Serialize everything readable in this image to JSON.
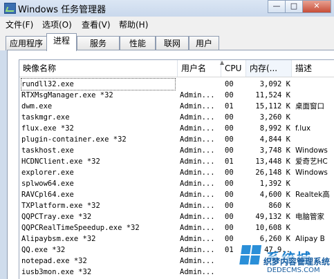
{
  "window": {
    "title": "Windows 任务管理器",
    "min_glyph": "—",
    "max_glyph": "□",
    "close_glyph": "✕"
  },
  "menu": [
    "文件(F)",
    "选项(O)",
    "查看(V)",
    "帮助(H)"
  ],
  "tabs": [
    {
      "label": "应用程序",
      "active": false
    },
    {
      "label": "进程",
      "active": true
    },
    {
      "label": "服务",
      "active": false
    },
    {
      "label": "性能",
      "active": false
    },
    {
      "label": "联网",
      "active": false
    },
    {
      "label": "用户",
      "active": false
    }
  ],
  "columns": [
    "映像名称",
    "用户名",
    "CPU",
    "内存(...",
    "描述"
  ],
  "processes": [
    {
      "name": "rundll32.exe",
      "user": "",
      "cpu": "00",
      "mem": "3,092 K",
      "desc": ""
    },
    {
      "name": "RTXMsgManager.exe *32",
      "user": "Admin...",
      "cpu": "00",
      "mem": "11,524 K",
      "desc": ""
    },
    {
      "name": "dwm.exe",
      "user": "Admin...",
      "cpu": "01",
      "mem": "15,112 K",
      "desc": "桌面窗口"
    },
    {
      "name": "taskmgr.exe",
      "user": "Admin...",
      "cpu": "00",
      "mem": "3,260 K",
      "desc": ""
    },
    {
      "name": "flux.exe *32",
      "user": "Admin...",
      "cpu": "00",
      "mem": "8,992 K",
      "desc": "f.lux"
    },
    {
      "name": "plugin-container.exe *32",
      "user": "Admin...",
      "cpu": "00",
      "mem": "4,844 K",
      "desc": ""
    },
    {
      "name": "taskhost.exe",
      "user": "Admin...",
      "cpu": "00",
      "mem": "3,748 K",
      "desc": "Windows"
    },
    {
      "name": "HCDNClient.exe *32",
      "user": "Admin...",
      "cpu": "01",
      "mem": "13,448 K",
      "desc": "爱奇艺HC"
    },
    {
      "name": "explorer.exe",
      "user": "Admin...",
      "cpu": "00",
      "mem": "26,148 K",
      "desc": "Windows"
    },
    {
      "name": "splwow64.exe",
      "user": "Admin...",
      "cpu": "00",
      "mem": "1,392 K",
      "desc": ""
    },
    {
      "name": "RAVCpl64.exe",
      "user": "Admin...",
      "cpu": "00",
      "mem": "4,600 K",
      "desc": "Realtek高"
    },
    {
      "name": "TXPlatform.exe *32",
      "user": "Admin...",
      "cpu": "00",
      "mem": "860 K",
      "desc": ""
    },
    {
      "name": "QQPCTray.exe *32",
      "user": "Admin...",
      "cpu": "00",
      "mem": "49,132 K",
      "desc": "电脑管家"
    },
    {
      "name": "QQPCRealTimeSpeedup.exe *32",
      "user": "Admin...",
      "cpu": "00",
      "mem": "10,608 K",
      "desc": ""
    },
    {
      "name": "Alipaybsm.exe *32",
      "user": "Admin...",
      "cpu": "00",
      "mem": "6,260 K",
      "desc": "Alipay B"
    },
    {
      "name": "QQ.exe *32",
      "user": "Admin...",
      "cpu": "01",
      "mem": "47,9..",
      "desc": ""
    },
    {
      "name": "notepad.exe *32",
      "user": "Admin...",
      "cpu": "",
      "mem": "",
      "desc": ""
    },
    {
      "name": "iusb3mon.exe *32",
      "user": "Admin...",
      "cpu": "",
      "mem": "",
      "desc": ""
    }
  ],
  "watermark": {
    "big": "系统城",
    "line1": "织梦内容管理系统",
    "line2": "DEDECMS.COM"
  },
  "colors": {
    "accent_blue": "#2a8fd8",
    "close_red": "#c74d37"
  }
}
